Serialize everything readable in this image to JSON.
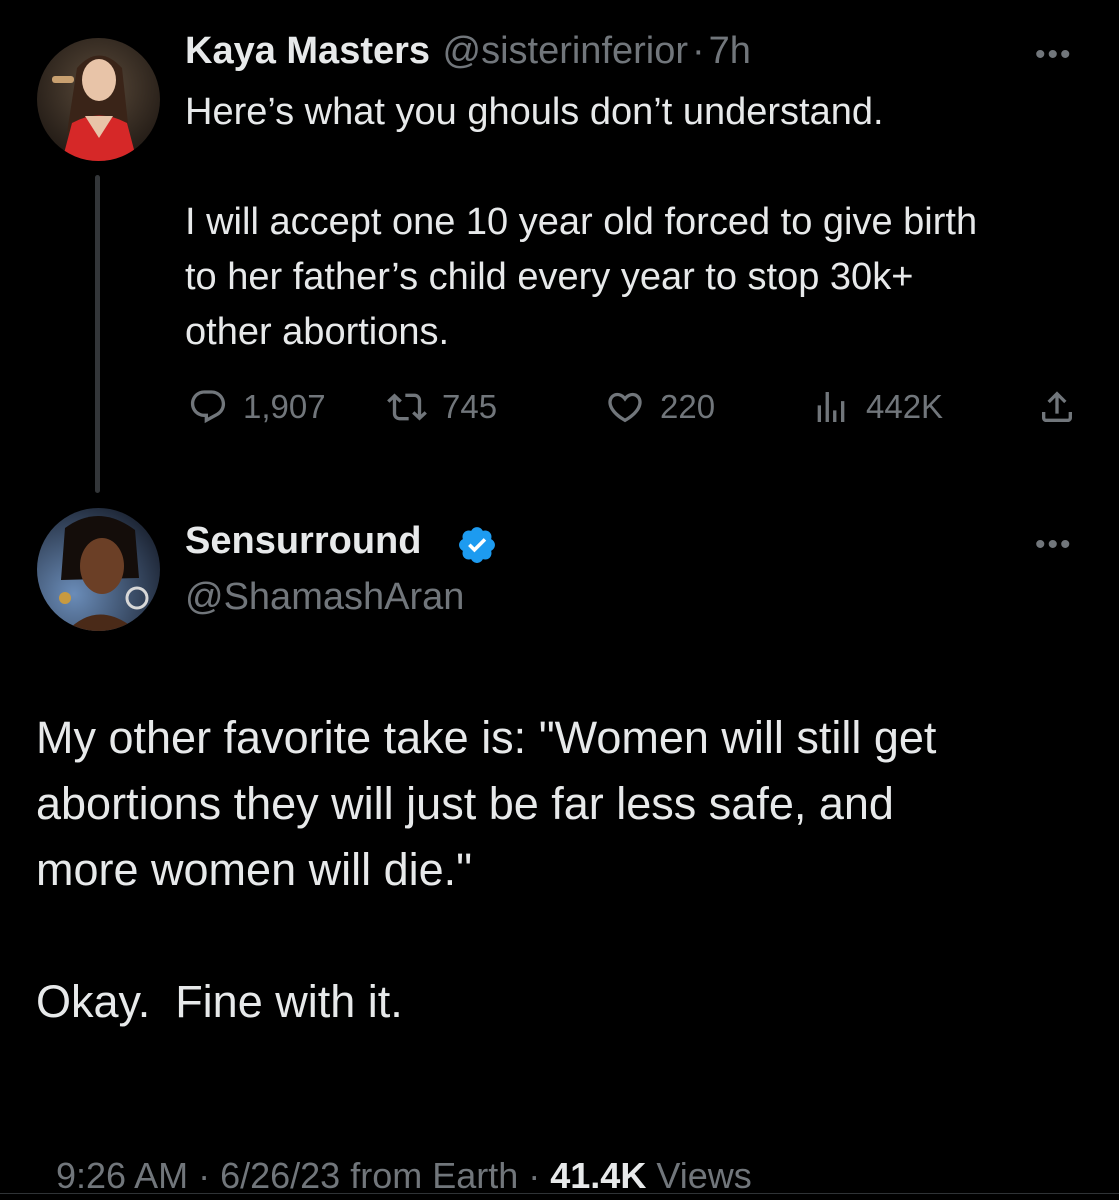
{
  "tweet1": {
    "author_name": "Kaya Masters",
    "author_handle": "@sisterinferior",
    "time": "7h",
    "separator": "·",
    "more_label": "•••",
    "text": "Here’s what you ghouls don’t understand.\n\nI will accept one 10 year old forced to give birth\nto her father’s child every year to stop 30k+\nother abortions.",
    "actions": {
      "replies": "1,907",
      "retweets": "745",
      "likes": "220",
      "views": "442K"
    },
    "icons": [
      "reply-icon",
      "retweet-icon",
      "like-icon",
      "views-icon",
      "share-icon"
    ]
  },
  "tweet2": {
    "author_name": "Sensurround",
    "author_handle": "@ShamashAran",
    "verified_color": "#1d9bf0",
    "more_label": "•••",
    "text": "My other favorite take is: \"Women will still get\nabortions they will just be far less safe, and\nmore women will die.\"\n\nOkay.  Fine with it.",
    "timestamp": "9:26 AM · 6/26/23 from Earth · ",
    "views_count": "41.4K",
    "views_label": " Views"
  }
}
